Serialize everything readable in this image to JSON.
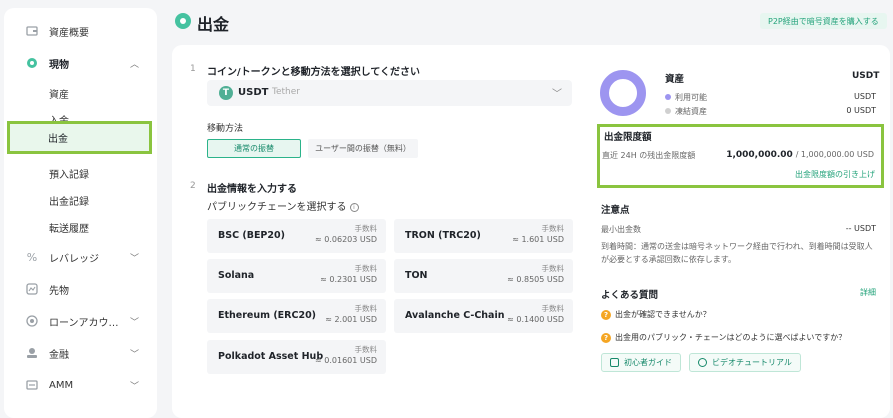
{
  "header": {
    "title": "出金",
    "p2p_link": "P2P経由で暗号資産を購入する"
  },
  "sidebar": {
    "items": [
      {
        "label": "資産概要",
        "icon": "wallet-icon"
      },
      {
        "label": "現物",
        "icon": "spot-icon"
      },
      {
        "label": "資産"
      },
      {
        "label": "入金"
      },
      {
        "label": "出金"
      },
      {
        "label": "預入記録"
      },
      {
        "label": "出金記録"
      },
      {
        "label": "転送履歴"
      },
      {
        "label": "レバレッジ",
        "icon": "percent-icon"
      },
      {
        "label": "先物",
        "icon": "futures-icon"
      },
      {
        "label": "ローンアカウ…",
        "icon": "loan-icon"
      },
      {
        "label": "金融",
        "icon": "finance-icon"
      },
      {
        "label": "AMM",
        "icon": "amm-icon"
      }
    ]
  },
  "step1": {
    "num": "1",
    "title": "コイン/トークンと移動方法を選択してください",
    "coin": {
      "symbol": "USDT",
      "name": "Tether",
      "logo": "T"
    },
    "method_label": "移動方法",
    "method_active": "通常の振替",
    "method_other": "ユーザー間の振替（無料）"
  },
  "step2": {
    "num": "2",
    "title": "出金情報を入力する",
    "chain_label": "パブリックチェーンを選択する",
    "fee_label": "手数料",
    "chains": [
      {
        "name": "BSC (BEP20)",
        "fee": "≈ 0.06203 USD"
      },
      {
        "name": "TRON (TRC20)",
        "fee": "≈ 1.601 USD"
      },
      {
        "name": "Solana",
        "fee": "≈ 0.2301 USD"
      },
      {
        "name": "TON",
        "fee": "≈ 0.8505 USD"
      },
      {
        "name": "Ethereum (ERC20)",
        "fee": "≈ 2.001 USD"
      },
      {
        "name": "Avalanche C-Chain",
        "fee": "≈ 0.1400 USD"
      },
      {
        "name": "Polkadot Asset Hub",
        "fee": "≈ 0.01601 USD"
      }
    ]
  },
  "assets": {
    "title": "資産",
    "currency": "USDT",
    "available_label": "利用可能",
    "available_value": "USDT",
    "frozen_label": "凍結資産",
    "frozen_value": "0 USDT",
    "available_color": "#9d95f0",
    "frozen_color": "#d0d0d0"
  },
  "limit": {
    "title": "出金限度額",
    "label": "直近 24H の残出金限度額",
    "remaining": "1,000,000.00",
    "total": "/ 1,000,000.00 USD",
    "raise_link": "出金限度額の引き上げ"
  },
  "notes": {
    "title": "注意点",
    "min_label": "最小出金数",
    "min_value": "-- USDT",
    "text": "到着時間：通常の送金は暗号ネットワーク経由で行われ、到着時間は受取人が必要とする承認回数に依存します。"
  },
  "faq": {
    "title": "よくある質問",
    "more": "詳細",
    "questions": [
      "出金が確認できませんか？",
      "出金用のパブリック・チェーンはどのように選べばよいですか？"
    ],
    "guide_btn": "初心者ガイド",
    "video_btn": "ビデオチュートリアル"
  }
}
